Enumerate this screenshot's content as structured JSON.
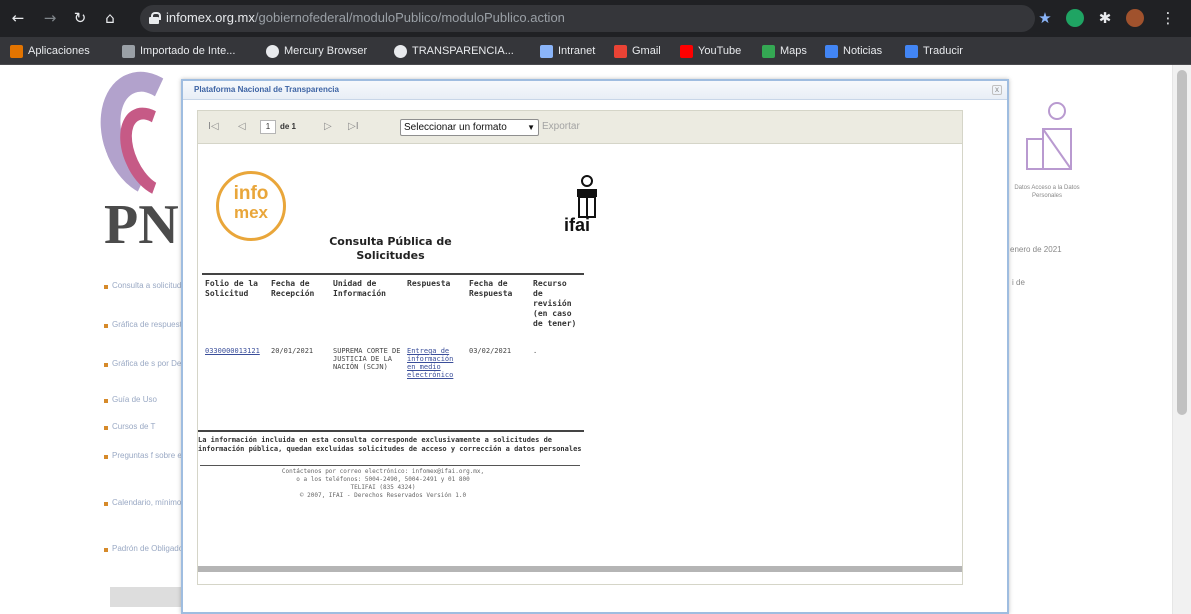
{
  "browser": {
    "url_host": "infomex.org.mx",
    "url_path": "/gobiernofederal/moduloPublico/moduloPublico.action",
    "bookmarks": [
      {
        "label": "Aplicaciones",
        "color": "#e37400"
      },
      {
        "label": "Importado de Inte...",
        "color": "#9aa0a6"
      },
      {
        "label": "Mercury Browser",
        "color": "#e8eaed"
      },
      {
        "label": "TRANSPARENCIA...",
        "color": "#e8eaed"
      },
      {
        "label": "Intranet",
        "color": "#8ab4f8"
      },
      {
        "label": "Gmail",
        "color": "#ea4335"
      },
      {
        "label": "YouTube",
        "color": "#ff0000"
      },
      {
        "label": "Maps",
        "color": "#34a853"
      },
      {
        "label": "Noticias",
        "color": "#4285f4"
      },
      {
        "label": "Traducir",
        "color": "#4285f4"
      }
    ]
  },
  "background_page": {
    "brand": "PN",
    "side_links": [
      "Consulta a solicitudes",
      "Gráfica de respuestas a s",
      "Gráfica de s por Dependen",
      "Guía de Uso",
      "Cursos de T",
      "Preguntas f sobre el acceso información pú",
      "Calendario, mínimos de la Nacional de Tr",
      "Padrón de Obligados"
    ],
    "right_text": "Datos Acceso a la Datos Personales",
    "date_fragment": "enero de 2021",
    "de_fragment": "i de"
  },
  "modal": {
    "title": "Plataforma Nacional de Transparencia",
    "close_glyph": "x"
  },
  "report_toolbar": {
    "first": "I◁",
    "prev": "◁",
    "page_value": "1",
    "page_of": "de 1",
    "next": "▷",
    "last": "▷I",
    "format_value": "Seleccionar un formato",
    "export_label": "Exportar"
  },
  "report": {
    "infomex_line1": "info",
    "infomex_line2": "mex",
    "ifai_label": "ifai",
    "title": "Consulta Pública de Solicitudes",
    "columns": [
      "Folio de la Solicitud",
      "Fecha de Recepción",
      "Unidad de Información",
      "Respuesta",
      "Fecha de Respuesta",
      "Recurso de revisión (en caso de tener)"
    ],
    "rows": [
      {
        "folio": "0330000013121",
        "fecha_recepcion": "20/01/2021",
        "unidad": "SUPREMA CORTE DE JUSTICIA DE LA NACIÓN (SCJN)",
        "respuesta": "Entrega de información en medio electrónico",
        "fecha_respuesta": "03/02/2021",
        "recurso": "."
      }
    ],
    "disclaimer": "La información incluida en esta consulta corresponde exclusivamente a solicitudes de información pública, quedan excluidas solicitudes de acceso y corrección a datos personales",
    "contact_lines": [
      "Contáctenos por correo electrónico: infomex@ifai.org.mx,",
      "o a los teléfonos: 5004-2490, 5004-2491 y 01 800",
      "TELIFAI (835 4324)",
      "© 2007, IFAI - Derechos Reservados Versión 1.0"
    ]
  }
}
